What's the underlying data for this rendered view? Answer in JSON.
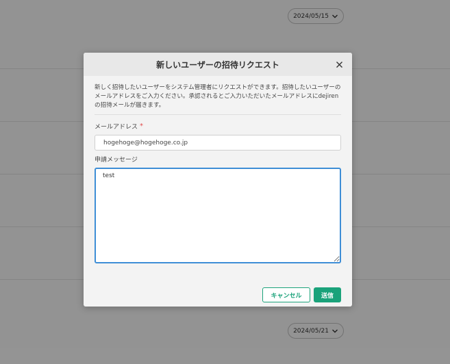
{
  "background": {
    "date_pills": [
      {
        "label": "2024/05/15"
      },
      {
        "label": "2024/05/21"
      }
    ]
  },
  "modal": {
    "title": "新しいユーザーの招待リクエスト",
    "description": "新しく招待したいユーザーをシステム管理者にリクエストができます。招待したいユーザーのメールアドレスをご入力ください。承認されるとご入力いただいたメールアドレスにdejirenの招待メールが届きます。",
    "email_label": "メールアドレス",
    "required_mark": "*",
    "email_value": "hogehoge@hogehoge.co.jp",
    "message_label": "申請メッセージ",
    "message_value": "test",
    "cancel_label": "キャンセル",
    "submit_label": "送信"
  },
  "colors": {
    "accent": "#1aa27a",
    "focus": "#3d8dd6",
    "required": "#e14c4c"
  }
}
